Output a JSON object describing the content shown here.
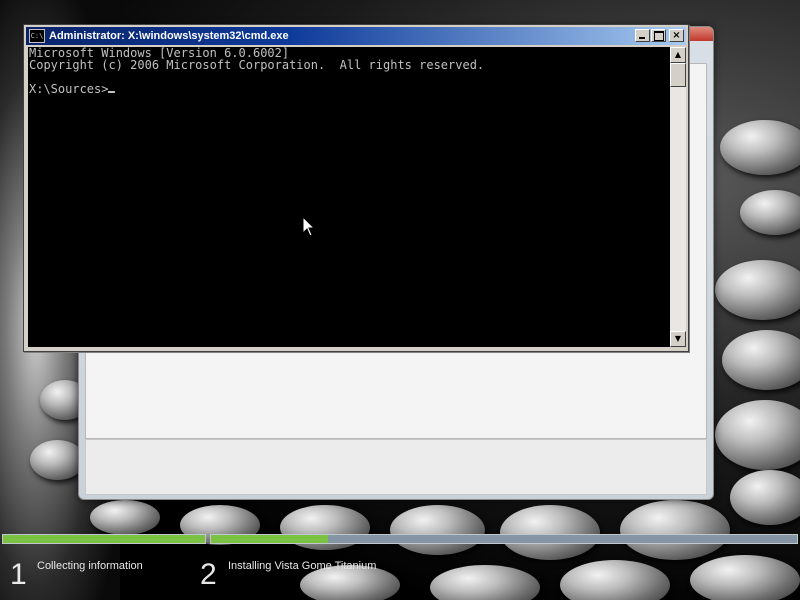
{
  "cmd": {
    "title": "Administrator: X:\\windows\\system32\\cmd.exe",
    "icon": "cmd-icon",
    "icon_text": "C:\\",
    "controls": {
      "minimize": "minimize-icon",
      "maximize": "maximize-icon",
      "close": "×"
    },
    "lines": [
      "Microsoft Windows [Version 6.0.6002]",
      "Copyright (c) 2006 Microsoft Corporation.  All rights reserved.",
      "",
      "X:\\Sources>"
    ],
    "colors": {
      "background": "#000000",
      "text": "#c0c0c0",
      "titlebar": "#0a246a"
    }
  },
  "setup_window": {
    "accent": "#c0392b"
  },
  "progress": {
    "steps": [
      {
        "number": "1",
        "label": "Collecting information",
        "fill": 1.0
      },
      {
        "number": "2",
        "label": "Installing Vista Gome Titanium",
        "fill": 0.2
      }
    ],
    "colors": {
      "fill": "#7cc242",
      "track": "#8595a3"
    }
  }
}
